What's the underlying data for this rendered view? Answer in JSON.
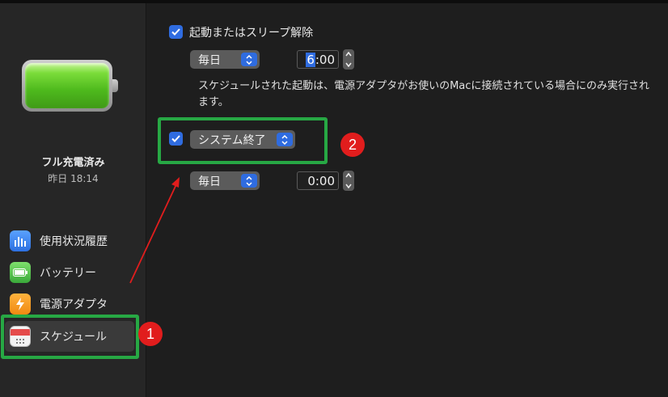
{
  "colors": {
    "accent": "#2f6ce0",
    "annotation_green": "#27a844",
    "annotation_red": "#e11d1d"
  },
  "battery": {
    "charge_percent": 100
  },
  "sidebar": {
    "status_title": "フル充電済み",
    "status_time": "昨日 18:14",
    "items": [
      {
        "label": "使用状況履歴",
        "icon": "bar-chart-icon"
      },
      {
        "label": "バッテリー",
        "icon": "battery-icon"
      },
      {
        "label": "電源アダプタ",
        "icon": "lightning-icon"
      },
      {
        "label": "スケジュール",
        "icon": "calendar-icon"
      }
    ]
  },
  "schedule": {
    "startup": {
      "checked": true,
      "label": "起動またはスリープ解除",
      "day": "毎日",
      "time_hour": "6",
      "time_rest": ":00"
    },
    "note": "スケジュールされた起動は、電源アダプタがお使いのMacに接続されている場合にのみ実行されます。",
    "shutdown": {
      "checked": true,
      "action": "システム終了",
      "day": "毎日",
      "time": "0:00"
    }
  },
  "annotations": {
    "badge1": "1",
    "badge2": "2"
  }
}
